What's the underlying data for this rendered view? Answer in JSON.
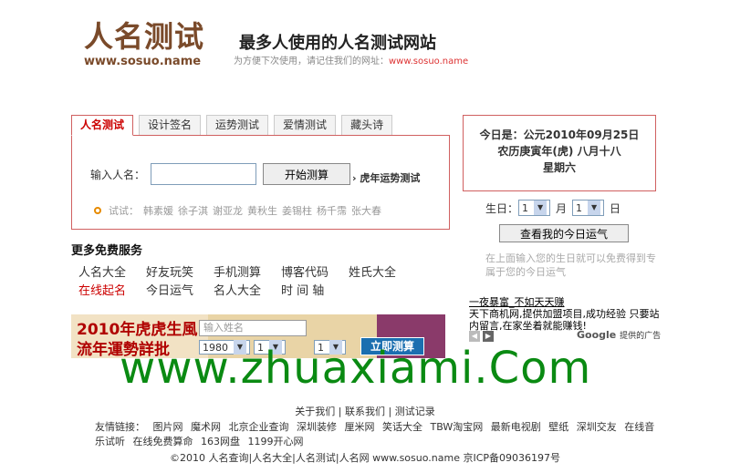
{
  "header": {
    "logo_text": "人名测试",
    "logo_url": "www.sosuo.name",
    "slogan": "最多人使用的人名测试网站",
    "hint_prefix": "为方便下次使用，请记住我们的网址：",
    "hint_url": "www.sosuo.name"
  },
  "tabs": [
    "人名测试",
    "设计签名",
    "运势测试",
    "爱情测试",
    "藏头诗"
  ],
  "name_test": {
    "input_label": "输入人名：",
    "input_value": "",
    "start_button": "开始测算",
    "tiger_link": "虎年运势测试",
    "try_label": "试试：",
    "try_names": [
      "韩素媛",
      "徐子淇",
      "谢亚龙",
      "黄秋生",
      "姜锡柱",
      "杨千霈",
      "张大春"
    ]
  },
  "date_box": {
    "line1": "今日是：公元2010年09月25日",
    "line2": "农历庚寅年(虎) 八月十八",
    "line3": "星期六"
  },
  "birthday": {
    "label": "生日：",
    "month_value": "1",
    "month_unit": "月",
    "day_value": "1",
    "day_unit": "日",
    "button": "查看我的今日运气",
    "note": "在上面输入您的生日就可以免费得到专属于您的今日运气"
  },
  "more_services": {
    "title": "更多免费服务",
    "rows": [
      [
        "人名大全",
        "好友玩笑",
        "手机测算",
        "博客代码",
        "姓氏大全"
      ],
      [
        "在线起名",
        "今日运气",
        "名人大全",
        "时 间 轴"
      ]
    ]
  },
  "banner": {
    "title1": "2010年虎虎生風",
    "title2": "流年運勢詳批",
    "input_placeholder": "输入姓名",
    "year_value": "1980",
    "month_value": "1",
    "day_value": "1",
    "go_button": "立即测算"
  },
  "ad": {
    "title": "一夜暴富_不如天天赚",
    "body": "天下商机网,提供加盟项目,成功经验 只要站内留言,在家坐着就能赚钱!",
    "google": "Google",
    "google_suffix": "提供的广告"
  },
  "watermark": "www.zhuaxiami.Com",
  "footer": {
    "links": "关于我们 | 联系我们 | 测试记录",
    "friends_label": "友情链接：",
    "friends": [
      "图片网",
      "魔术网",
      "北京企业查询",
      "深圳装修",
      "厘米网",
      "笑话大全",
      "TBW淘宝网",
      "最新电视剧",
      "壁纸",
      "深圳交友",
      "在线音乐试听",
      "在线免费算命",
      "163网盘",
      "1199开心网"
    ],
    "copyright": "©2010 人名查询|人名大全|人名测试|人名网  www.sosuo.name 京ICP备09036197号"
  },
  "colors": {
    "brand": "#7a4a2a",
    "accent_red": "#c00000",
    "panel_border": "#d06060",
    "watermark": "#0a8a12"
  }
}
